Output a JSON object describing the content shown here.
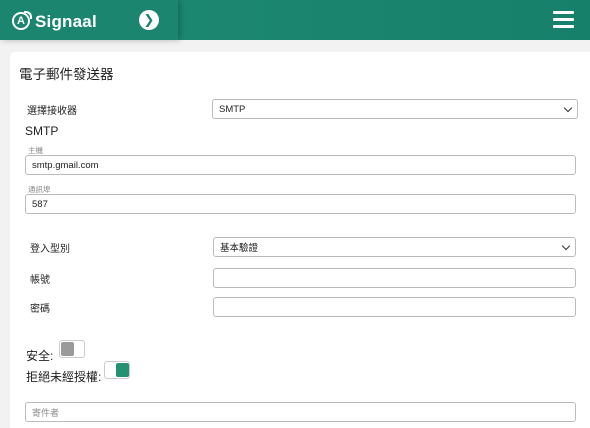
{
  "brand": {
    "name": "Signaal",
    "logo_icon": "signaal-logo-icon"
  },
  "header": {
    "collapse_icon": "chevron-right-icon",
    "menu_icon": "hamburger-menu-icon",
    "accent": "#1b856f"
  },
  "page": {
    "title": "電子郵件發送器"
  },
  "form": {
    "receiver_label": "選擇接收器",
    "receiver_value": "SMTP",
    "section_title": "SMTP",
    "host_label": "主機",
    "host_value": "smtp.gmail.com",
    "port_label": "通訊埠",
    "port_value": "587",
    "login_type_label": "登入型別",
    "login_type_value": "基本驗證",
    "account_label": "帳號",
    "account_value": "",
    "password_label": "密碼",
    "password_value": "",
    "secure_label": "安全:",
    "secure_on": false,
    "reject_unauth_label": "拒絕未經授權:",
    "reject_unauth_on": true,
    "sender_placeholder": "寄件者"
  }
}
